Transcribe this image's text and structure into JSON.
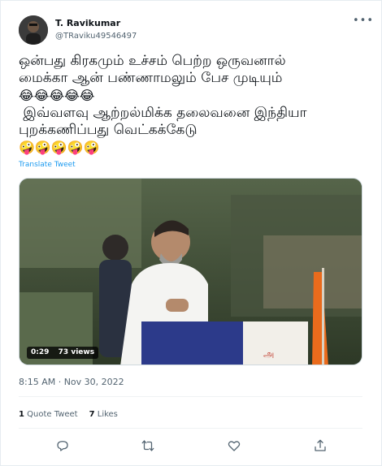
{
  "author": {
    "name": "T. Ravikumar",
    "handle": "@TRaviku49546497",
    "avatar_icon": "avatar-portrait"
  },
  "more_label": "•••",
  "tweet": {
    "line1": "ஒன்பது கிரகமும் உச்சம் பெற்ற ஒருவனால்",
    "line2": "மைக்கா ஆன் பண்ணாமலும் பேச முடியும்",
    "emoji_row1": "😂😂😂😂😂",
    "line3": " இவ்வளவு ஆற்றல்மிக்க தலைவனை இந்தியா",
    "line4": "புறக்கணிப்பது வெட்கக்கேடு",
    "emoji_row2": "🤪🤪🤪🤪🤪"
  },
  "translate_label": "Translate Tweet",
  "media": {
    "duration": "0:29",
    "views": "73 views"
  },
  "timestamp": "8:15 AM · Nov 30, 2022",
  "stats": {
    "quote_count": "1",
    "quote_label": "Quote Tweet",
    "likes_count": "7",
    "likes_label": "Likes"
  },
  "actions": {
    "reply_icon": "reply-icon",
    "retweet_icon": "retweet-icon",
    "like_icon": "like-icon",
    "share_icon": "share-icon"
  },
  "colors": {
    "accent": "#1d9bf0",
    "secondary_text": "#536471",
    "primary_text": "#0f1419",
    "border": "#eff3f4"
  }
}
